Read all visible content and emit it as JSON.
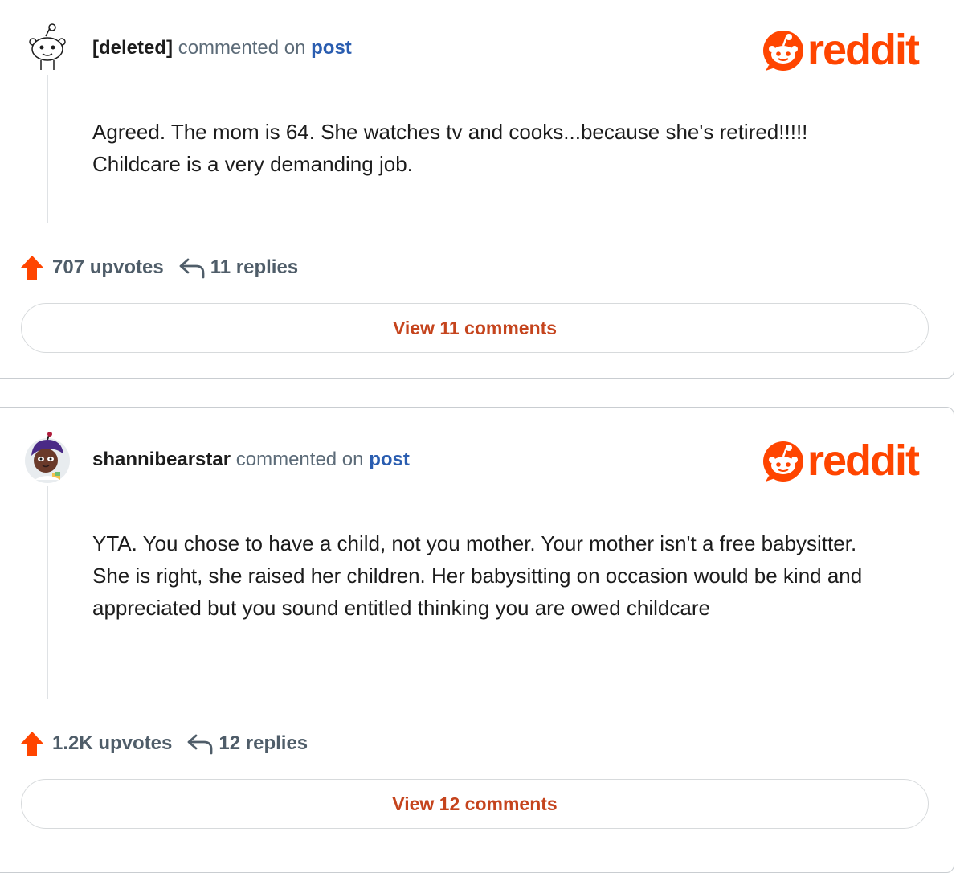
{
  "brand": {
    "logo_text": "reddit",
    "color": "#ff4500"
  },
  "comments": [
    {
      "author": "[deleted]",
      "commented_on": "commented on",
      "post_link": "post",
      "body": "Agreed. The mom is 64. She watches tv and cooks...because she's retired!!!!! Childcare is a very demanding job.",
      "upvotes": "707 upvotes",
      "replies": "11 replies",
      "view_button": "View 11 comments"
    },
    {
      "author": "shannibearstar",
      "commented_on": "commented on",
      "post_link": "post",
      "body": "YTA. You chose to have a child, not you mother. Your mother isn't a free babysitter. She is right, she raised her children. Her babysitting on occasion would be kind and appreciated but you sound entitled thinking you are owed childcare",
      "upvotes": "1.2K upvotes",
      "replies": "12 replies",
      "view_button": "View 12 comments"
    }
  ]
}
